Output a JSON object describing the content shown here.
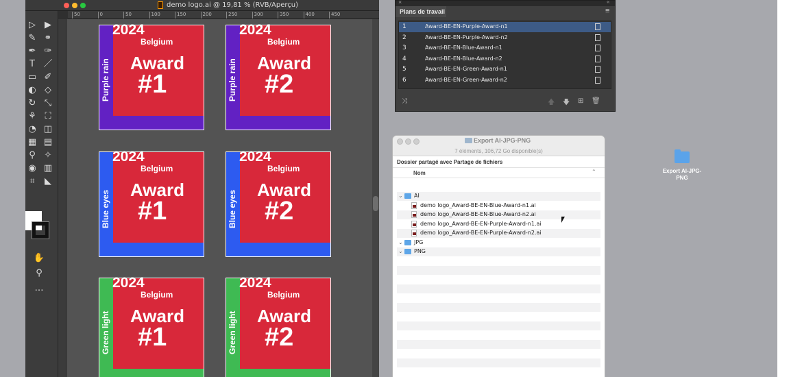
{
  "illustrator": {
    "title": "demo logo.ai @ 19,81 % (RVB/Aperçu)",
    "ruler_marks": [
      "50",
      "0",
      "50",
      "100",
      "150",
      "200",
      "250",
      "300",
      "350",
      "400",
      "450"
    ],
    "tools": [
      "▷",
      "▶",
      "✎",
      "⚭",
      "✒",
      "✑",
      "T",
      "／",
      "▭",
      "✐",
      "◐",
      "◇",
      "↻",
      "⤡",
      "⚘",
      "⛶",
      "◔",
      "◫",
      "▦",
      "▤",
      "⚲",
      "✧",
      "◉",
      "▥",
      "⌗",
      "◣",
      "✋",
      "⚲",
      "…"
    ],
    "artboards": [
      {
        "year": "2024",
        "country": "Belgium",
        "award": "Award",
        "number": "#1",
        "side_label": "Purple rain",
        "color": "#6221c3"
      },
      {
        "year": "2024",
        "country": "Belgium",
        "award": "Award",
        "number": "#2",
        "side_label": "Purple rain",
        "color": "#6221c3"
      },
      {
        "year": "2024",
        "country": "Belgium",
        "award": "Award",
        "number": "#1",
        "side_label": "Blue eyes",
        "color": "#2d5bf0"
      },
      {
        "year": "2024",
        "country": "Belgium",
        "award": "Award",
        "number": "#2",
        "side_label": "Blue eyes",
        "color": "#2d5bf0"
      },
      {
        "year": "2024",
        "country": "Belgium",
        "award": "Award",
        "number": "#1",
        "side_label": "Green light",
        "color": "#3fba53"
      },
      {
        "year": "2024",
        "country": "Belgium",
        "award": "Award",
        "number": "#2",
        "side_label": "Green light",
        "color": "#3fba53"
      }
    ]
  },
  "artboards_panel": {
    "close": "×",
    "collapse": "«",
    "tab": "Plans de travail",
    "menu": "≡",
    "rows": [
      {
        "num": "1",
        "name": "Award-BE-EN-Purple-Award-n1",
        "selected": true
      },
      {
        "num": "2",
        "name": "Award-BE-EN-Purple-Award-n2",
        "selected": false
      },
      {
        "num": "3",
        "name": "Award-BE-EN-Blue-Award-n1",
        "selected": false
      },
      {
        "num": "4",
        "name": "Award-BE-EN-Blue-Award-n2",
        "selected": false
      },
      {
        "num": "5",
        "name": "Award-BE-EN-Green-Award-n1",
        "selected": false
      },
      {
        "num": "6",
        "name": "Award-BE-EN-Green-Award-n2",
        "selected": false
      }
    ],
    "footer_icons": {
      "rearrange": "⤨",
      "up": "🡅",
      "down": "🡇",
      "new": "⊞",
      "delete": "🗑"
    }
  },
  "finder": {
    "title": "Export AI-JPG-PNG",
    "status": "7 éléments, 106,72 Go disponible(s)",
    "location": "Dossier partagé avec Partage de fichiers",
    "column": "Nom",
    "sort_indicator": "⌃",
    "rows": [
      {
        "type": "folder",
        "label": "AI",
        "chevron": "⌄"
      },
      {
        "type": "file",
        "label": "demo logo_Award-BE-EN-Blue-Award-n1.ai"
      },
      {
        "type": "file",
        "label": "demo logo_Award-BE-EN-Blue-Award-n2.ai"
      },
      {
        "type": "file",
        "label": "demo logo_Award-BE-EN-Purple-Award-n1.ai"
      },
      {
        "type": "file",
        "label": "demo logo_Award-BE-EN-Purple-Award-n2.ai"
      },
      {
        "type": "folder",
        "label": "JPG",
        "chevron": "⌄"
      },
      {
        "type": "folder",
        "label": "PNG",
        "chevron": "⌄"
      }
    ]
  },
  "desktop": {
    "folder_label": "Export AI-JPG-PNG"
  },
  "colors": {
    "award_red": "#d8283a",
    "selection_blue": "#3d5b86",
    "folder_blue": "#5ea6e8"
  }
}
